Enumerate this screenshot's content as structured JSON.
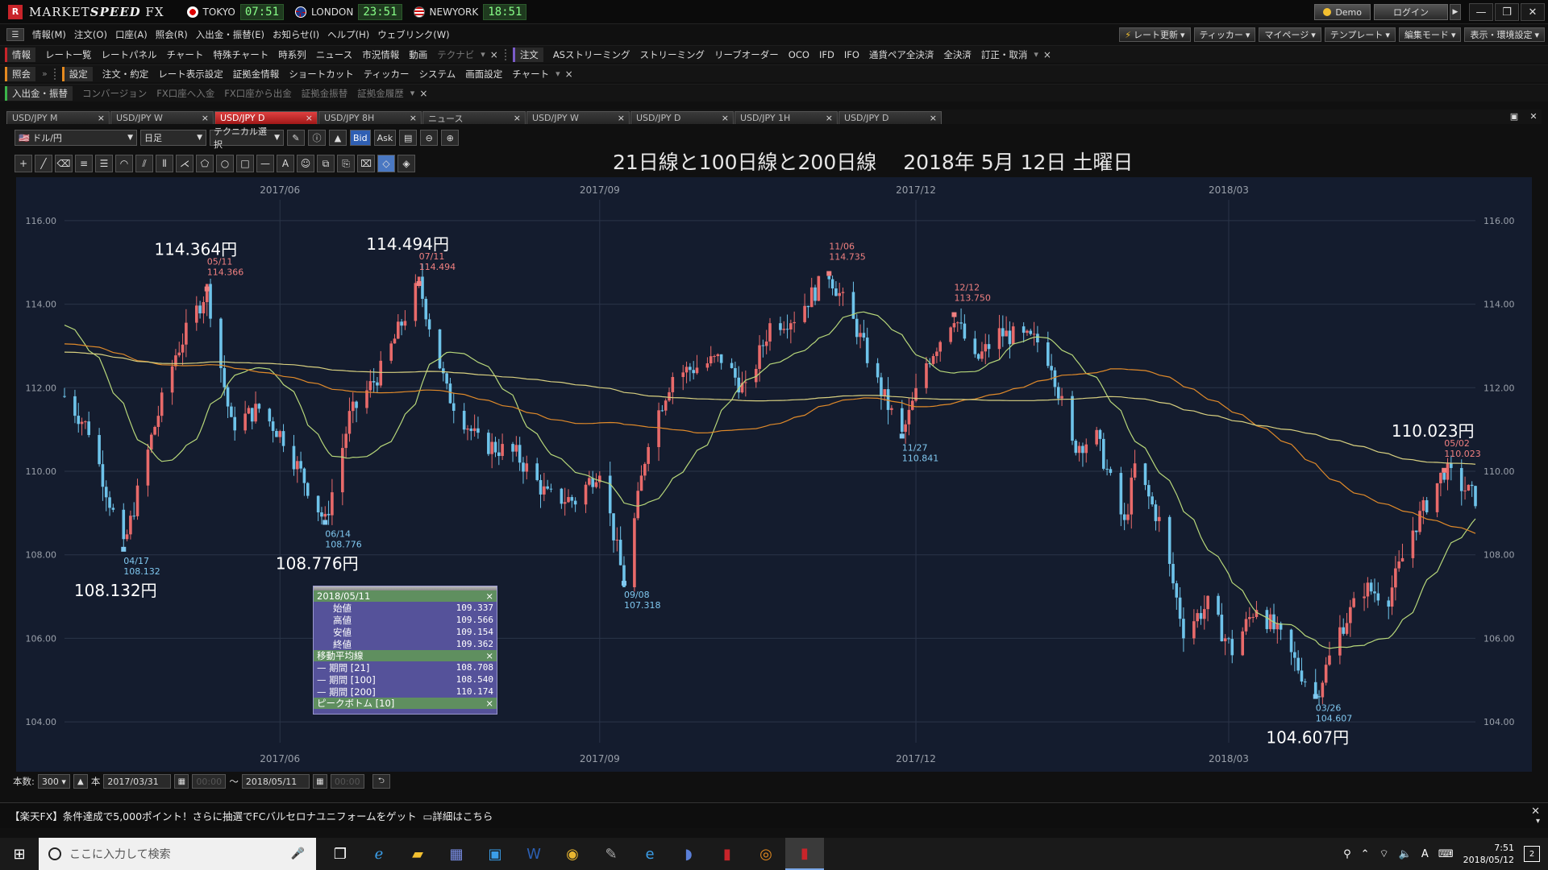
{
  "titlebar": {
    "app_logo": "R",
    "app_name_prefix": "MARKET",
    "app_name_bold": "SPEED",
    "app_name_suffix": " FX",
    "clocks": [
      {
        "city": "TOKYO",
        "time": "07:51"
      },
      {
        "city": "LONDON",
        "time": "23:51"
      },
      {
        "city": "NEWYORK",
        "time": "18:51"
      }
    ],
    "demo_label": "Demo",
    "login_label": "ログイン",
    "window_buttons": [
      "—",
      "❐",
      "✕"
    ]
  },
  "menubar": {
    "items": [
      "情報(M)",
      "注文(O)",
      "口座(A)",
      "照会(R)",
      "入出金・振替(E)",
      "お知らせ(I)",
      "ヘルプ(H)",
      "ウェブリンク(W)"
    ],
    "right_buttons": [
      "レート更新",
      "ティッカー",
      "マイページ",
      "テンプレート",
      "編集モード",
      "表示・環境設定"
    ]
  },
  "toolrow1": {
    "group1_label": "情報",
    "group1_items": [
      "レート一覧",
      "レートパネル",
      "チャート",
      "特殊チャート",
      "時系列",
      "ニュース",
      "市況情報",
      "動画"
    ],
    "group1_dim": "テクナビ",
    "group2_label": "注文",
    "group2_items": [
      "ASストリーミング",
      "ストリーミング",
      "リーブオーダー",
      "OCO",
      "IFD",
      "IFO",
      "通貨ペア全決済",
      "全決済",
      "訂正・取消"
    ]
  },
  "toolrow2": {
    "group1_label": "照会",
    "group2_label": "設定",
    "group2_items": [
      "注文・約定",
      "レート表示設定",
      "証拠金情報",
      "ショートカット",
      "ティッカー",
      "システム",
      "画面設定",
      "チャート"
    ]
  },
  "toolrow3": {
    "group1_label": "入出金・振替",
    "items": [
      "コンバージョン",
      "FX口座へ入金",
      "FX口座から出金",
      "証拠金振替",
      "証拠金履歴"
    ]
  },
  "tabs": [
    "USD/JPY M",
    "USD/JPY W",
    "USD/JPY D",
    "USD/JPY 8H",
    "ニュース",
    "USD/JPY W",
    "USD/JPY D",
    "USD/JPY 1H",
    "USD/JPY D"
  ],
  "active_tab": 2,
  "chart_toolbar": {
    "pair": "ドル/円",
    "period": "日足",
    "technical": "テクニカル選択",
    "bid": "Bid",
    "ask": "Ask"
  },
  "chart_title": "21日線と100日線と200日線　 2018年 5月 12日 土曜日",
  "chart_data": {
    "type": "candlestick",
    "x_range": [
      "2017/03/31",
      "2018/05/11"
    ],
    "ylim": [
      103.5,
      116.5
    ],
    "y_ticks": [
      "116.00",
      "114.00",
      "112.00",
      "110.00",
      "108.00",
      "106.00",
      "104.00"
    ],
    "x_ticks": [
      "2017/06",
      "2017/09",
      "2017/12",
      "2018/03"
    ],
    "grid": true,
    "anchors": [
      [
        "2017-03-31",
        111.8
      ],
      [
        "2017-04-07",
        111.0
      ],
      [
        "2017-04-17",
        108.132
      ],
      [
        "2017-04-25",
        110.8
      ],
      [
        "2017-05-02",
        112.8
      ],
      [
        "2017-05-11",
        114.366
      ],
      [
        "2017-05-18",
        111.1
      ],
      [
        "2017-05-26",
        111.5
      ],
      [
        "2017-06-02",
        110.8
      ],
      [
        "2017-06-14",
        108.776
      ],
      [
        "2017-06-21",
        111.3
      ],
      [
        "2017-06-30",
        112.4
      ],
      [
        "2017-07-11",
        114.494
      ],
      [
        "2017-07-19",
        111.9
      ],
      [
        "2017-07-28",
        110.7
      ],
      [
        "2017-08-08",
        110.4
      ],
      [
        "2017-08-17",
        109.4
      ],
      [
        "2017-08-25",
        109.3
      ],
      [
        "2017-09-01",
        110.1
      ],
      [
        "2017-09-08",
        107.318
      ],
      [
        "2017-09-15",
        110.8
      ],
      [
        "2017-09-22",
        112.3
      ],
      [
        "2017-09-29",
        112.5
      ],
      [
        "2017-10-06",
        112.7
      ],
      [
        "2017-10-13",
        111.9
      ],
      [
        "2017-10-20",
        113.5
      ],
      [
        "2017-10-27",
        113.7
      ],
      [
        "2017-11-06",
        114.735
      ],
      [
        "2017-11-14",
        113.4
      ],
      [
        "2017-11-20",
        112.1
      ],
      [
        "2017-11-27",
        110.841
      ],
      [
        "2017-12-04",
        112.6
      ],
      [
        "2017-12-12",
        113.75
      ],
      [
        "2017-12-18",
        112.6
      ],
      [
        "2017-12-25",
        113.3
      ],
      [
        "2018-01-05",
        113.1
      ],
      [
        "2018-01-09",
        112.6
      ],
      [
        "2018-01-15",
        110.6
      ],
      [
        "2018-01-22",
        110.8
      ],
      [
        "2018-01-30",
        108.7
      ],
      [
        "2018-02-02",
        110.1
      ],
      [
        "2018-02-09",
        108.8
      ],
      [
        "2018-02-16",
        106.2
      ],
      [
        "2018-02-23",
        106.8
      ],
      [
        "2018-03-02",
        105.7
      ],
      [
        "2018-03-09",
        106.8
      ],
      [
        "2018-03-16",
        106.0
      ],
      [
        "2018-03-26",
        104.607
      ],
      [
        "2018-04-02",
        106.2
      ],
      [
        "2018-04-09",
        107.2
      ],
      [
        "2018-04-16",
        107.0
      ],
      [
        "2018-04-23",
        108.6
      ],
      [
        "2018-05-02",
        110.023
      ],
      [
        "2018-05-09",
        109.5
      ],
      [
        "2018-05-11",
        109.362
      ]
    ],
    "series": [
      {
        "name": "期間 [21]",
        "color": "#b7d77a"
      },
      {
        "name": "期間 [100]",
        "color": "#e08a2a"
      },
      {
        "name": "期間 [200]",
        "color": "#d8d080"
      }
    ],
    "peaks": [
      {
        "date": "2017-04-17",
        "label": "04/17",
        "value": "108.132",
        "big": "108.132円",
        "dir": "low"
      },
      {
        "date": "2017-05-11",
        "label": "05/11",
        "value": "114.366",
        "big": "114.364円",
        "dir": "high"
      },
      {
        "date": "2017-06-14",
        "label": "06/14",
        "value": "108.776",
        "big": "108.776円",
        "dir": "low"
      },
      {
        "date": "2017-07-11",
        "label": "07/11",
        "value": "114.494",
        "big": "114.494円",
        "dir": "high"
      },
      {
        "date": "2017-09-08",
        "label": "09/08",
        "value": "107.318",
        "big": "",
        "dir": "low"
      },
      {
        "date": "2017-11-06",
        "label": "11/06",
        "value": "114.735",
        "big": "",
        "dir": "high"
      },
      {
        "date": "2017-11-27",
        "label": "11/27",
        "value": "110.841",
        "big": "",
        "dir": "low"
      },
      {
        "date": "2017-12-12",
        "label": "12/12",
        "value": "113.750",
        "big": "",
        "dir": "high"
      },
      {
        "date": "2018-03-26",
        "label": "03/26",
        "value": "104.607",
        "big": "104.607円",
        "dir": "low"
      },
      {
        "date": "2018-05-02",
        "label": "05/02",
        "value": "110.023",
        "big": "110.023円",
        "dir": "high"
      }
    ],
    "colors": {
      "up": "#e86a6a",
      "down": "#6ec3ea",
      "grid": "#2a3448",
      "bg": "#141c2e",
      "axis_text": "#9aa0aa",
      "high_label": "#f08080",
      "low_label": "#80c8f0"
    }
  },
  "info_popup": {
    "date": "2018/05/11",
    "rows": [
      {
        "label": "始値",
        "value": "109.337"
      },
      {
        "label": "高値",
        "value": "109.566"
      },
      {
        "label": "安値",
        "value": "109.154"
      },
      {
        "label": "終値",
        "value": "109.362"
      }
    ],
    "ma_title": "移動平均線",
    "ma_rows": [
      {
        "label": "期間 [21]",
        "value": "108.708"
      },
      {
        "label": "期間 [100]",
        "value": "108.540"
      },
      {
        "label": "期間 [200]",
        "value": "110.174"
      }
    ],
    "peak_title": "ピークボトム [10]"
  },
  "bottom_bar": {
    "count_label": "本数:",
    "count_value": "300",
    "count_unit": "本",
    "from_date": "2017/03/31",
    "from_time": "00:00",
    "tilde": "〜",
    "to_date": "2018/05/11",
    "to_time": "00:00"
  },
  "ticker": {
    "message": "【楽天FX】条件達成で5,000ポイント！さらに抽選でFCバルセロナユニフォームをゲット",
    "link": "詳細はこちら"
  },
  "taskbar": {
    "search_placeholder": "ここに入力して検索",
    "ime": "A",
    "time": "7:51",
    "date": "2018/05/12",
    "notifications": "2"
  }
}
